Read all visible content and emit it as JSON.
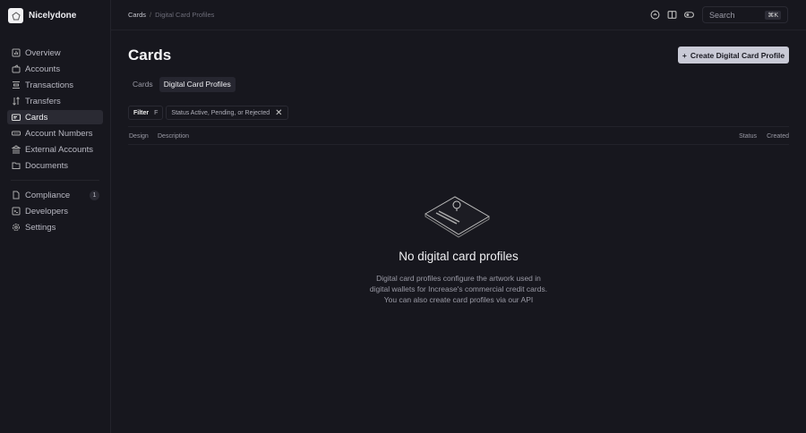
{
  "org": {
    "name": "Nicelydone"
  },
  "sidebar": {
    "items": [
      {
        "label": "Overview",
        "icon": "chart-icon"
      },
      {
        "label": "Accounts",
        "icon": "wallet-icon"
      },
      {
        "label": "Transactions",
        "icon": "list-icon"
      },
      {
        "label": "Transfers",
        "icon": "arrows-icon"
      },
      {
        "label": "Cards",
        "icon": "card-icon",
        "active": true
      },
      {
        "label": "Account Numbers",
        "icon": "number-icon"
      },
      {
        "label": "External Accounts",
        "icon": "bank-icon"
      },
      {
        "label": "Documents",
        "icon": "folder-icon"
      }
    ],
    "secondary": [
      {
        "label": "Compliance",
        "icon": "document-icon",
        "badge": "1"
      },
      {
        "label": "Developers",
        "icon": "terminal-icon"
      },
      {
        "label": "Settings",
        "icon": "gear-icon"
      }
    ]
  },
  "breadcrumb": {
    "parent": "Cards",
    "separator": "/",
    "current": "Digital Card Profiles"
  },
  "search": {
    "placeholder": "Search",
    "shortcut": "⌘K"
  },
  "page": {
    "title": "Cards",
    "create_label": "Create Digital Card Profile"
  },
  "tabs": [
    {
      "label": "Cards"
    },
    {
      "label": "Digital Card Profiles",
      "active": true
    }
  ],
  "filters": {
    "filter_label": "Filter",
    "filter_key": "F",
    "status": "Status Active, Pending, or Rejected"
  },
  "table": {
    "columns": [
      "Design",
      "Description",
      "Status",
      "Created"
    ]
  },
  "empty": {
    "title": "No digital card profiles",
    "lines": [
      "Digital card profiles configure the artwork used in",
      "digital wallets for Increase's commercial credit cards.",
      "You can also create card profiles via our API"
    ]
  }
}
